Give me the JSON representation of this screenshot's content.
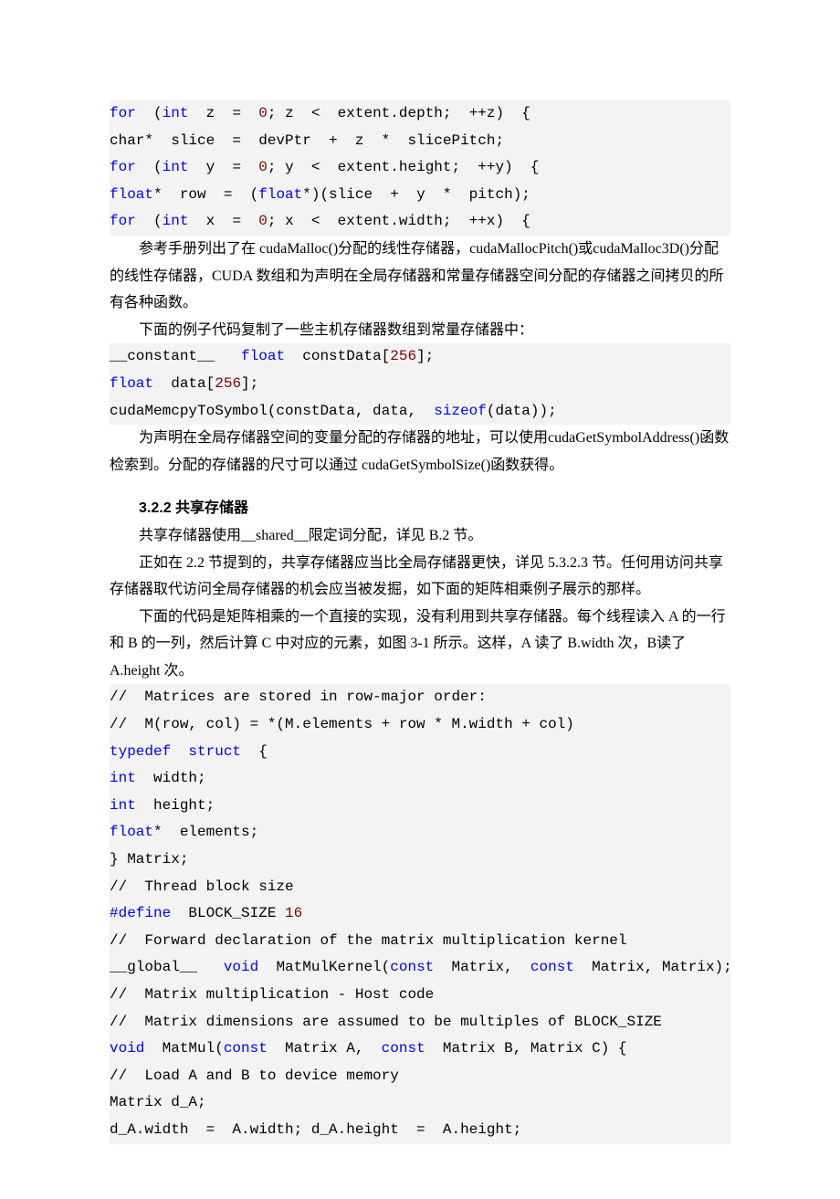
{
  "code1": {
    "l1a": "for  ",
    "l1b": "(",
    "l1c": "int",
    "l1d": "  z  =  ",
    "l1e": "0",
    "l1f": "; z  <  extent.depth;  ++z)  {",
    "l2": "char*  slice  =  devPtr  +  z  *  slicePitch;",
    "l3a": "for  ",
    "l3b": "(",
    "l3c": "int",
    "l3d": "  y  =  ",
    "l3e": "0",
    "l3f": "; y  <  extent.height;  ++y)  {",
    "l4a": "float",
    "l4b": "*  row  =  (",
    "l4c": "float",
    "l4d": "*)(slice  +  y  *  pitch);",
    "l5a": "for  ",
    "l5b": "(",
    "l5c": "int",
    "l5d": "  x  =  ",
    "l5e": "0",
    "l5f": "; x  <  extent.width;  ++x)  {"
  },
  "para1": "参考手册列出了在 cudaMalloc()分配的线性存储器，cudaMallocPitch()或cudaMalloc3D()分配的线性存储器，CUDA 数组和为声明在全局存储器和常量存储器空间分配的存储器之间拷贝的所有各种函数。",
  "para2": "下面的例子代码复制了一些主机存储器数组到常量存储器中：",
  "code2": {
    "l1a": "__constant__   ",
    "l1b": "float",
    "l1c": "  constData[",
    "l1d": "256",
    "l1e": "];",
    "l2a": "float",
    "l2b": "  data[",
    "l2c": "256",
    "l2d": "];",
    "l3a": "cudaMemcpyToSymbol(constData, data,  ",
    "l3b": "sizeof",
    "l3c": "(data));"
  },
  "para3": "为声明在全局存储器空间的变量分配的存储器的地址，可以使用cudaGetSymbolAddress()函数检索到。分配的存储器的尺寸可以通过 cudaGetSymbolSize()函数获得。",
  "heading": "3.2.2 共享存储器",
  "para4": "共享存储器使用__shared__限定词分配，详见 B.2 节。",
  "para5": "正如在 2.2 节提到的，共享存储器应当比全局存储器更快，详见 5.3.2.3 节。任何用访问共享存储器取代访问全局存储器的机会应当被发掘，如下面的矩阵相乘例子展示的那样。",
  "para6": "下面的代码是矩阵相乘的一个直接的实现，没有利用到共享存储器。每个线程读入 A 的一行和 B 的一列，然后计算 C 中对应的元素，如图 3-1 所示。这样，A 读了 B.width 次，B读了 A.height 次。",
  "code3": {
    "c1": "//  Matrices are stored in row-major order:",
    "c2": "//  M(row, col) = *(M.elements + row * M.width + col)",
    "l3a": "typedef  ",
    "l3b": "struct",
    "l3c": "  {",
    "l4a": "int",
    "l4b": "  width;",
    "l5a": "int",
    "l5b": "  height;",
    "l6a": "float",
    "l6b": "*  elements;",
    "l7": "} Matrix;",
    "c8": "//  Thread block size",
    "l9a": "#define",
    "l9b": "  BLOCK_SIZE ",
    "l9c": "16",
    "c10": "//  Forward declaration of the matrix multiplication kernel",
    "l11a": "__global__   ",
    "l11b": "void",
    "l11c": "  MatMulKernel(",
    "l11d": "const",
    "l11e": "  Matrix,  ",
    "l11f": "const",
    "l11g": "  Matrix, Matrix);",
    "c12": "//  Matrix multiplication - Host code",
    "c13": "//  Matrix dimensions are assumed to be multiples of BLOCK_SIZE",
    "l14a": "void",
    "l14b": "  MatMul(",
    "l14c": "const",
    "l14d": "  Matrix A,  ",
    "l14e": "const",
    "l14f": "  Matrix B, Matrix C) {",
    "c15": "//  Load A and B to device memory",
    "l16": "Matrix d_A;",
    "l17": "d_A.width  =  A.width; d_A.height  =  A.height;"
  }
}
